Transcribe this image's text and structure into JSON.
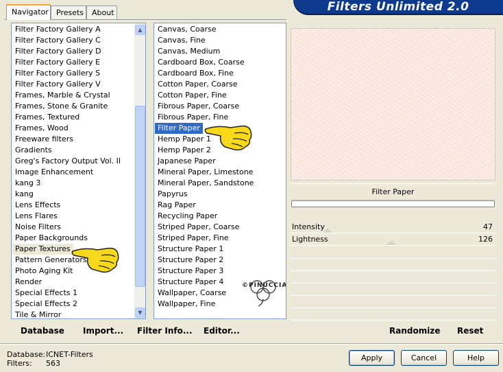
{
  "banner": {
    "title": "Filters Unlimited 2.0"
  },
  "tabs": [
    {
      "label": "Navigator",
      "active": true
    },
    {
      "label": "Presets",
      "active": false
    },
    {
      "label": "About",
      "active": false
    }
  ],
  "categories": {
    "items": [
      "Filter Factory Gallery A",
      "Filter Factory Gallery C",
      "Filter Factory Gallery D",
      "Filter Factory Gallery E",
      "Filter Factory Gallery S",
      "Filter Factory Gallery V",
      "Frames, Marble & Crystal",
      "Frames, Stone & Granite",
      "Frames, Textured",
      "Frames, Wood",
      "Freeware filters",
      "Gradients",
      "Greg's Factory Output Vol. II",
      "Image Enhancement",
      "kang 3",
      "kang",
      "Lens Effects",
      "Lens Flares",
      "Noise Filters",
      "Paper Backgrounds",
      "Paper Textures",
      "Pattern Generators",
      "Photo Aging Kit",
      "Render",
      "Special Effects 1",
      "Special Effects 2",
      "Tile & Mirror"
    ],
    "selected": "Paper Textures"
  },
  "filters": {
    "items": [
      "Canvas, Coarse",
      "Canvas, Fine",
      "Canvas, Medium",
      "Cardboard Box, Coarse",
      "Cardboard Box, Fine",
      "Cotton Paper, Coarse",
      "Cotton Paper, Fine",
      "Fibrous Paper, Coarse",
      "Fibrous Paper, Fine",
      "Filter Paper",
      "Hemp Paper 1",
      "Hemp Paper 2",
      "Japanese Paper",
      "Mineral Paper, Limestone",
      "Mineral Paper, Sandstone",
      "Papyrus",
      "Rag Paper",
      "Recycling Paper",
      "Striped Paper, Coarse",
      "Striped Paper, Fine",
      "Structure Paper 1",
      "Structure Paper 2",
      "Structure Paper 3",
      "Structure Paper 4",
      "Wallpaper, Coarse",
      "Wallpaper, Fine"
    ],
    "selected": "Filter Paper"
  },
  "preview": {
    "filter_name": "Filter Paper"
  },
  "params": [
    {
      "label": "Intensity",
      "value": "47",
      "level": 0.18
    },
    {
      "label": "Lightness",
      "value": "126",
      "level": 0.49
    }
  ],
  "toolbar": {
    "database": "Database",
    "import": "Import...",
    "filter_info": "Filter Info...",
    "editor": "Editor...",
    "randomize": "Randomize",
    "reset": "Reset"
  },
  "status": {
    "database_label": "Database:",
    "database_value": "ICNET-Filters",
    "filters_label": "Filters:",
    "filters_value": "563"
  },
  "buttons": {
    "apply": "Apply",
    "cancel": "Cancel",
    "help": "Help"
  },
  "watermark": "©PINUCCIA",
  "colors": {
    "banner": "#0d3a8c",
    "selection": "#316ac5",
    "tab_accent": "#f2a52e"
  }
}
